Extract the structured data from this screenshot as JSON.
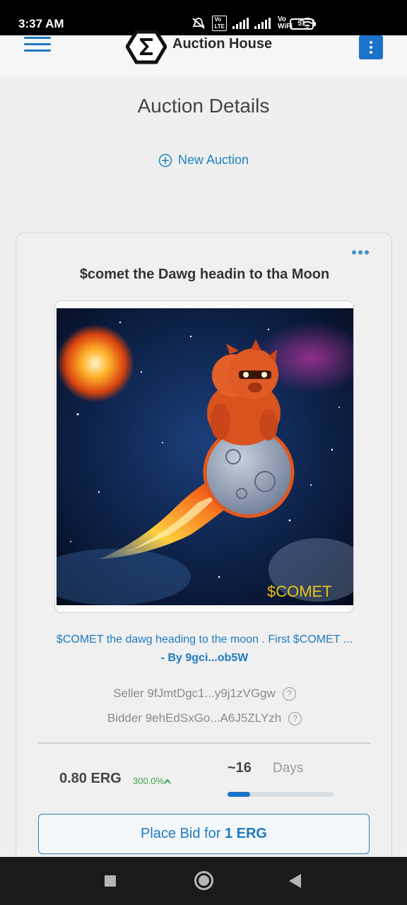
{
  "status_bar": {
    "time": "3:37 AM",
    "battery": "51",
    "icons": [
      "mute-icon",
      "volte-icon",
      "signal-icon",
      "signal-icon",
      "vowifi-icon",
      "wifi-icon",
      "battery-icon"
    ]
  },
  "header": {
    "brand": "Auction House",
    "menu_icon": "hamburger-icon",
    "logo_icon": "sigma-logo-icon",
    "more_icon": "kebab-icon"
  },
  "page": {
    "title": "Auction Details",
    "new_auction_label": "New Auction"
  },
  "auction": {
    "title": "$comet the Dawg headin to tha Moon",
    "image_watermark": "$COMET",
    "description": "$COMET the dawg heading to the moon . First $COMET ...",
    "by": "- By 9gci...ob5W",
    "seller": "Seller 9fJmtDgc1...y9j1zVGgw",
    "bidder": "Bidder 9ehEdSxGo...A6J5ZLYzh",
    "help_glyph": "?",
    "price": "0.80 ERG",
    "increase": "300.0%",
    "days_num": "~16",
    "days_label": "Days",
    "time_progress": 0.21,
    "bid_prefix": "Place Bid for ",
    "bid_amount": "1 ERG"
  },
  "colors": {
    "accent": "#1e82c0",
    "primary_button": "#1a73c9",
    "increase": "#3fa24a"
  },
  "nav_bar": {
    "recents_icon": "square-icon",
    "home_icon": "circle-icon",
    "back_icon": "triangle-back-icon"
  }
}
